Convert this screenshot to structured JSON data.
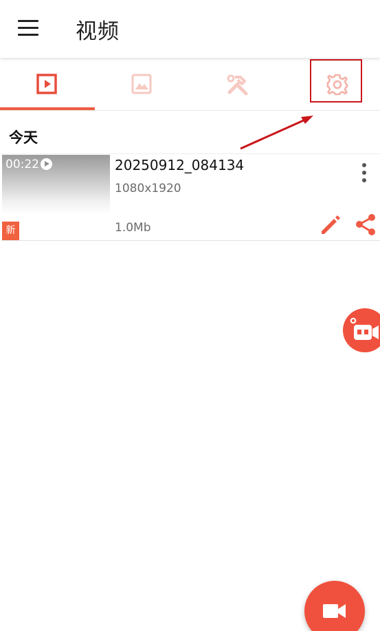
{
  "appbar": {
    "title": "视频",
    "menu_icon": "hamburger-menu-icon"
  },
  "tabs": [
    {
      "icon": "video-play-icon",
      "selected": true
    },
    {
      "icon": "image-icon",
      "selected": false
    },
    {
      "icon": "tools-icon",
      "selected": false
    },
    {
      "icon": "gear-icon",
      "selected": false
    }
  ],
  "annotation": {
    "highlight_target": "settings-tab",
    "color": "#c9161b"
  },
  "section": {
    "label": "今天"
  },
  "videos": [
    {
      "duration": "00:22",
      "badge": "新",
      "name": "20250912_084134",
      "resolution": "1080x1920",
      "size": "1.0Mb"
    }
  ],
  "floating_buttons": {
    "record_toolbox_icon": "camera-toolbox-icon",
    "fab_icon": "video-camera-icon"
  },
  "colors": {
    "accent": "#ef5a44",
    "tab_inactive": "#f6c9c1"
  }
}
